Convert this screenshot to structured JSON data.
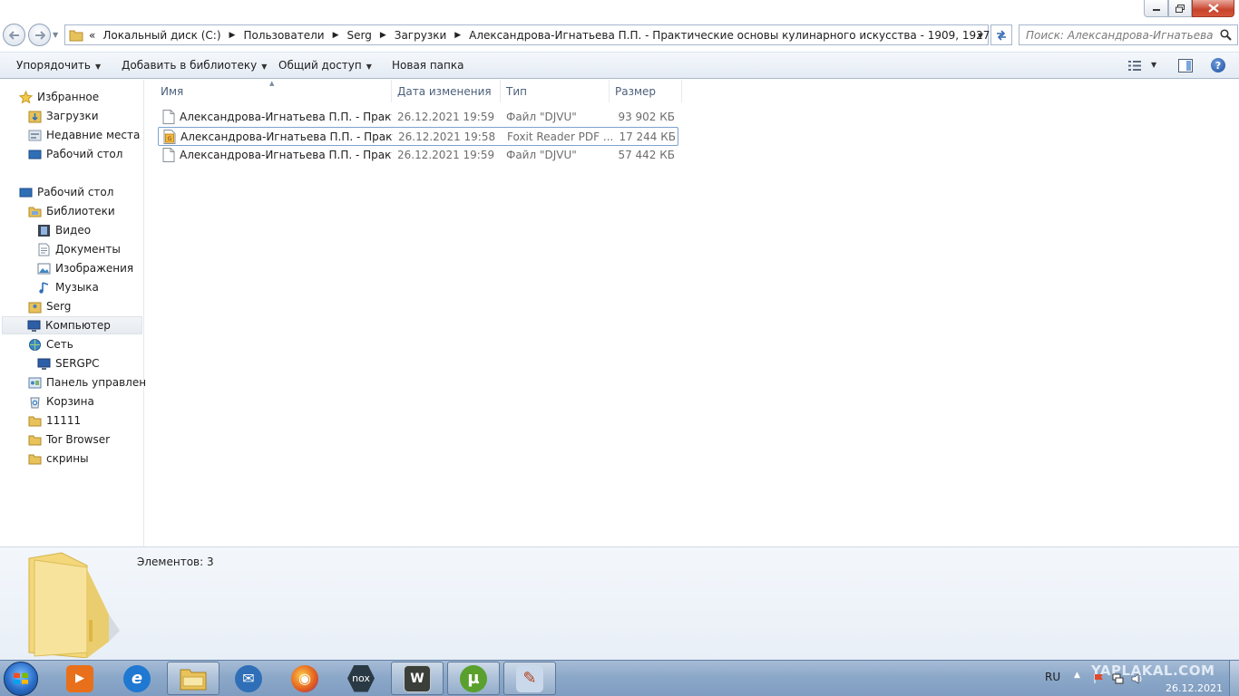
{
  "window": {
    "controls": {
      "minimize": "—",
      "maximize": "□",
      "close": "✕"
    }
  },
  "address": {
    "overflow": "«",
    "crumbs": [
      "Локальный диск (C:)",
      "Пользователи",
      "Serg",
      "Загрузки",
      "Александрова-Игнатьева П.П. - Практические основы кулинарного искусства - 1909, 1927"
    ],
    "search_placeholder": "Поиск: Александрова-Игнатьева П...."
  },
  "toolbar": {
    "organize": "Упорядочить",
    "add_to_library": "Добавить в библиотеку",
    "share": "Общий доступ",
    "new_folder": "Новая папка"
  },
  "navigation": {
    "favorites": {
      "label": "Избранное",
      "items": [
        "Загрузки",
        "Недавние места",
        "Рабочий стол"
      ]
    },
    "desktop": "Рабочий стол",
    "libraries": {
      "label": "Библиотеки",
      "items": [
        "Видео",
        "Документы",
        "Изображения",
        "Музыка"
      ]
    },
    "user": "Serg",
    "computer": "Компьютер",
    "network": {
      "label": "Сеть",
      "items": [
        "SERGPC"
      ]
    },
    "control_panel": "Панель управления",
    "recycle_bin": "Корзина",
    "folders": [
      "11111",
      "Tor Browser",
      "скрины"
    ]
  },
  "columns": {
    "name": "Имя",
    "date": "Дата изменения",
    "type": "Тип",
    "size": "Размер"
  },
  "files": [
    {
      "name": "Александрова-Игнатьева П.П. - Практи...",
      "date": "26.12.2021 19:59",
      "type": "Файл \"DJVU\"",
      "size": "93 902 КБ",
      "icon": "djvu-file-icon",
      "selected": false
    },
    {
      "name": "Александрова-Игнатьева П.П. - Практи...",
      "date": "26.12.2021 19:58",
      "type": "Foxit Reader PDF ...",
      "size": "17 244 КБ",
      "icon": "pdf-file-icon",
      "selected": true
    },
    {
      "name": "Александрова-Игнатьева П.П. - Практи...",
      "date": "26.12.2021 19:59",
      "type": "Файл \"DJVU\"",
      "size": "57 442 КБ",
      "icon": "djvu-file-icon",
      "selected": false
    }
  ],
  "details": {
    "item_count": "Элементов: 3"
  },
  "taskbar": {
    "apps": [
      {
        "name": "media-player",
        "active": false,
        "color": "#e8701a",
        "glyph": "▶"
      },
      {
        "name": "internet-explorer",
        "active": false,
        "color": "#1f78d1",
        "glyph": "e"
      },
      {
        "name": "windows-explorer",
        "active": true,
        "color": "#e8c25a",
        "glyph": ""
      },
      {
        "name": "thunderbird",
        "active": false,
        "color": "#2f6fb8",
        "glyph": "✉"
      },
      {
        "name": "firefox",
        "active": false,
        "color": "#e25a1c",
        "glyph": "◉"
      },
      {
        "name": "nox-player",
        "active": false,
        "color": "#2a3a45",
        "glyph": "nox"
      },
      {
        "name": "world-of-tanks",
        "active": true,
        "color": "#3a3f3a",
        "glyph": "W"
      },
      {
        "name": "utorrent",
        "active": true,
        "color": "#5aa02c",
        "glyph": "µ"
      },
      {
        "name": "paint",
        "active": true,
        "color": "#c9d8ea",
        "glyph": "✎"
      }
    ],
    "language": "RU",
    "tray_chevron": "▲",
    "watermark": "YAPLAKAL.COM",
    "date": "26.12.2021"
  }
}
